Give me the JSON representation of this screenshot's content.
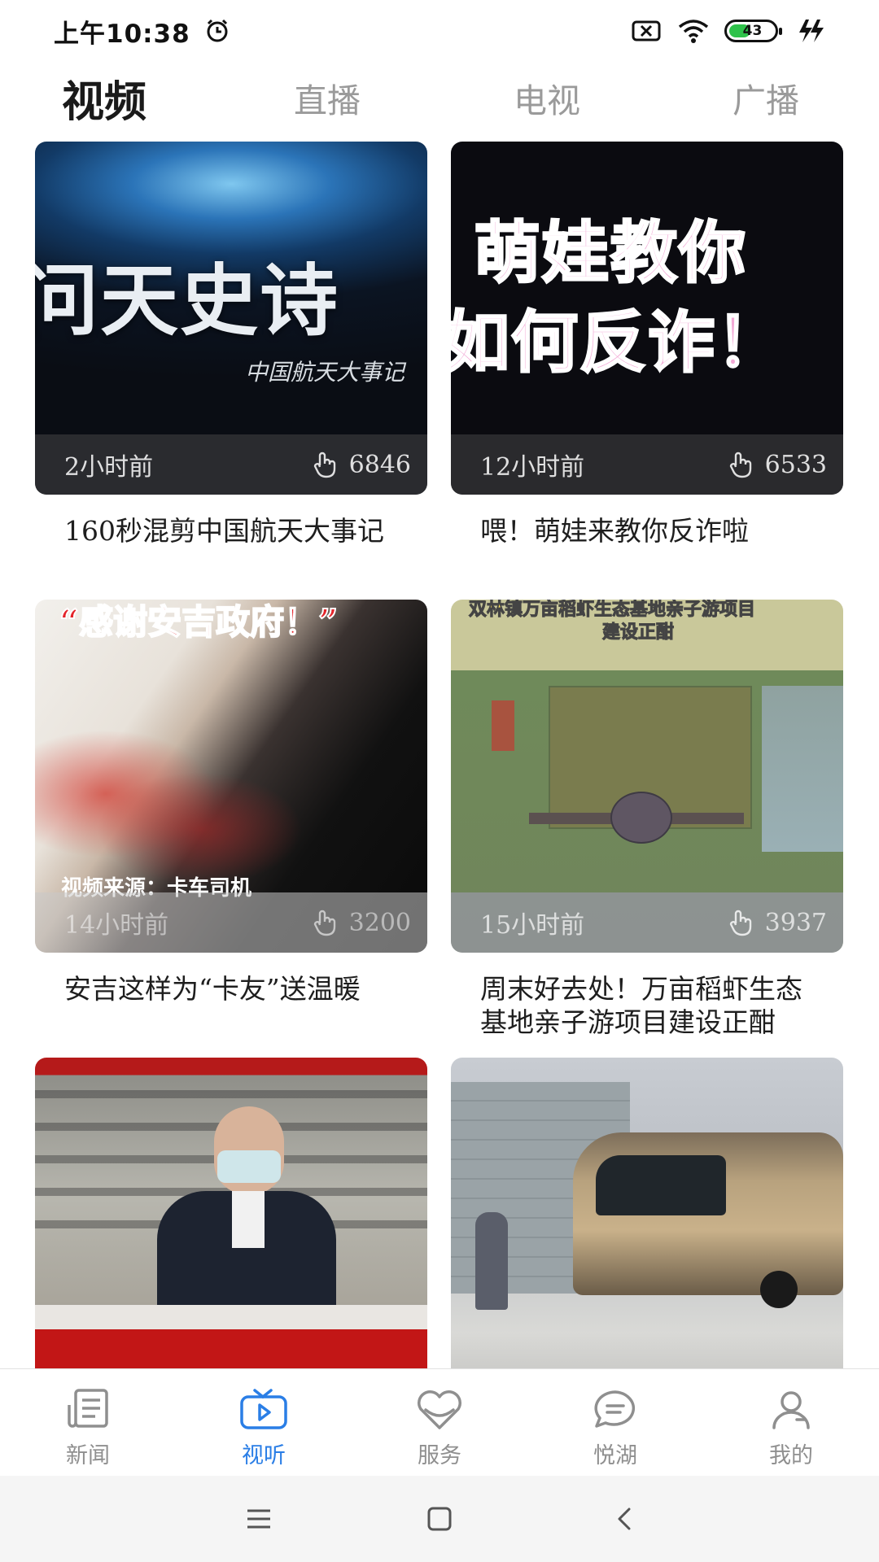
{
  "status_bar": {
    "time": "上午10:38",
    "battery_level": "43",
    "battery_fraction": 0.43,
    "icons": [
      "alarm-icon",
      "sim-off-icon",
      "wifi-icon",
      "battery-icon",
      "charging-icon"
    ]
  },
  "top_tabs": [
    {
      "label": "视频",
      "active": true
    },
    {
      "label": "直播",
      "active": false
    },
    {
      "label": "电视",
      "active": false
    },
    {
      "label": "广播",
      "active": false
    }
  ],
  "videos": [
    {
      "time": "2小时前",
      "views": "6846",
      "title": "160秒混剪中国航天大事记",
      "overlay_main": "问天史诗",
      "overlay_sub": "中国航天大事记"
    },
    {
      "time": "12小时前",
      "views": "6533",
      "title": "喂！萌娃来教你反诈啦",
      "overlay_line1": "萌娃教你",
      "overlay_line2": "如何反诈！"
    },
    {
      "time": "14小时前",
      "views": "3200",
      "title": "安吉这样为“卡友”送温暖",
      "overlay_top": "“感谢安吉政府！”",
      "overlay_bottom": "视频来源：卡车司机"
    },
    {
      "time": "15小时前",
      "views": "3937",
      "title": "周末好去处！万亩稻虾生态基地亲子游项目建设正酣",
      "overlay_line1": "双林镇万亩稻虾生态基地亲子游项目",
      "overlay_line2": "建设正酣"
    },
    {
      "time": "",
      "views": "",
      "title": ""
    },
    {
      "time": "",
      "views": "",
      "title": ""
    }
  ],
  "bottom_nav": [
    {
      "label": "新闻",
      "icon": "news-icon",
      "active": false
    },
    {
      "label": "视听",
      "icon": "tv-play-icon",
      "active": true
    },
    {
      "label": "服务",
      "icon": "heart-service-icon",
      "active": false
    },
    {
      "label": "悦湖",
      "icon": "chat-bubble-icon",
      "active": false
    },
    {
      "label": "我的",
      "icon": "user-icon",
      "active": false
    }
  ],
  "colors": {
    "accent": "#2a7ee6",
    "inactive": "#8f8f8f",
    "battery": "#2ec24a"
  }
}
